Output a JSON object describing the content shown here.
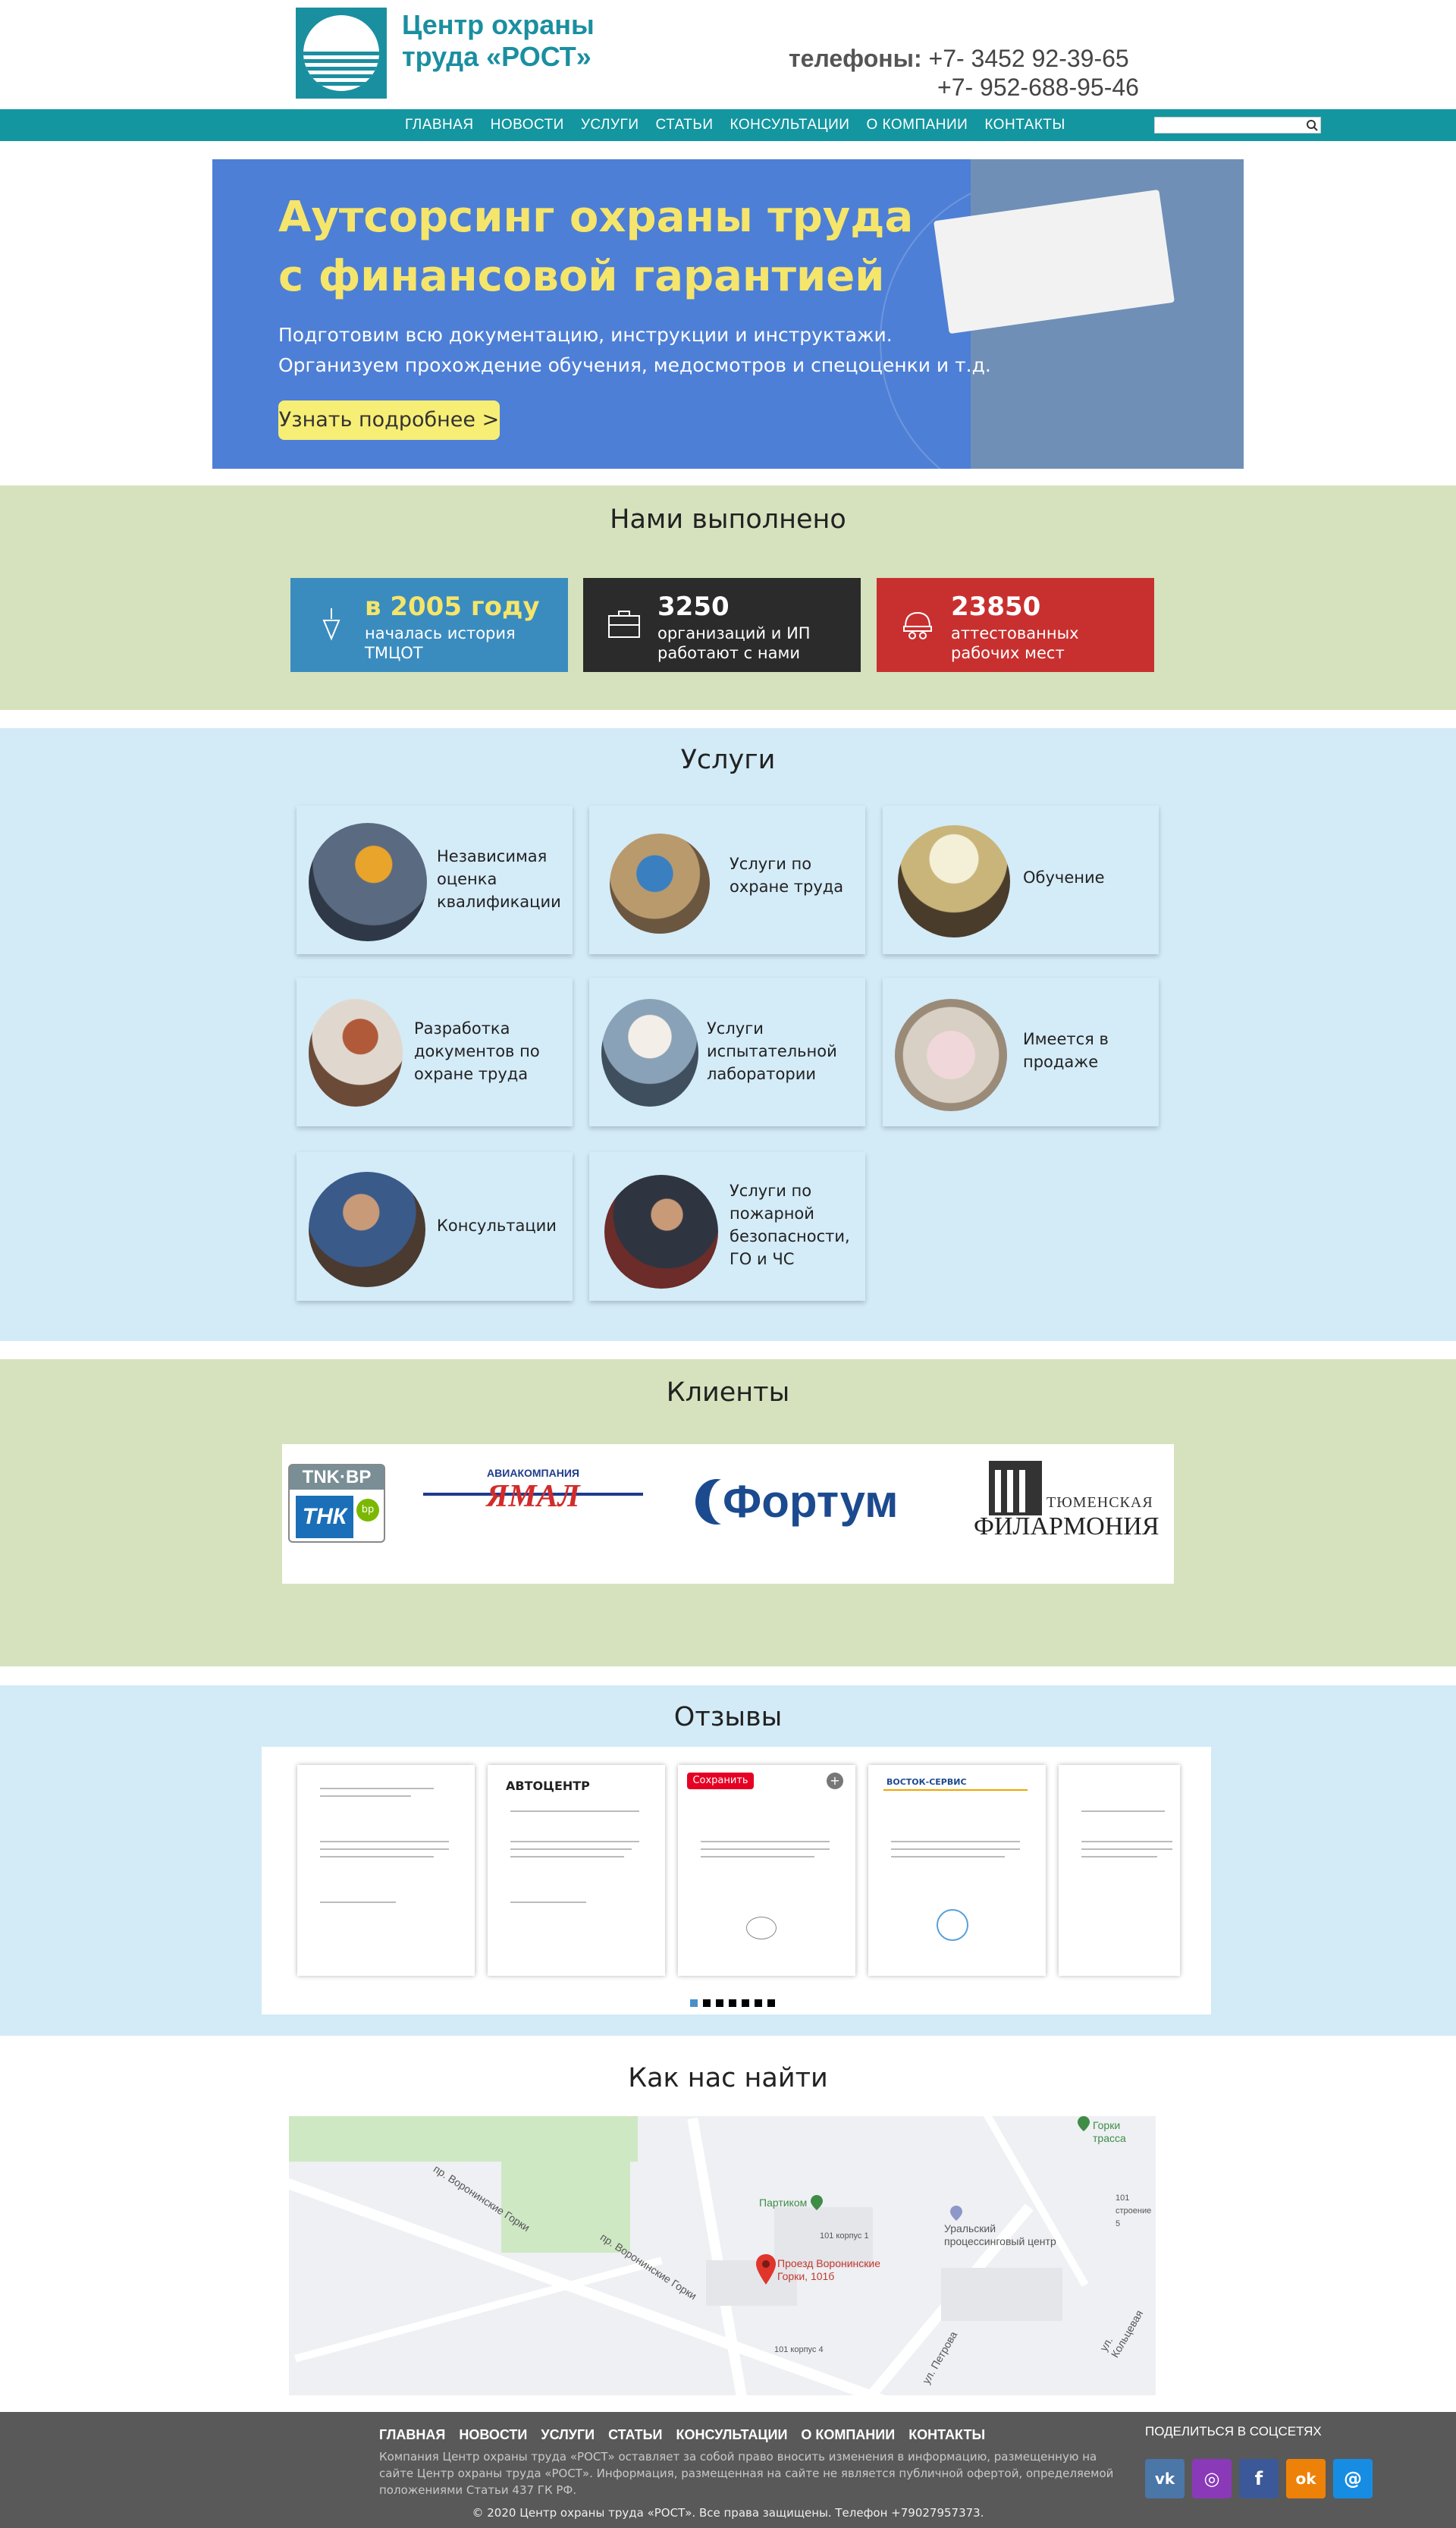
{
  "header": {
    "logo_line1": "Центр охраны",
    "logo_line2": "труда «РОСТ»",
    "phones_label": "телефоны:",
    "phone1": "+7- 3452 92-39-65",
    "phone2": "+7- 952-688-95-46"
  },
  "nav": {
    "items": [
      "ГЛАВНАЯ",
      "НОВОСТИ",
      "УСЛУГИ",
      "СТАТЬИ",
      "КОНСУЛЬТАЦИИ",
      "О КОМПАНИИ",
      "КОНТАКТЫ"
    ],
    "search_placeholder": ""
  },
  "banner": {
    "title_line1": "Аутсорсинг охраны труда",
    "title_line2": "с финансовой гарантией",
    "sub_line1": "Подготовим всю документацию, инструкции и инструктажи.",
    "sub_line2": "Организуем прохождение обучения, медосмотров и спецоценки и т.д.",
    "button": "Узнать подробнее >"
  },
  "done": {
    "title": "Нами выполнено",
    "stats": [
      {
        "big": "в 2005 году",
        "small": "началась история ТМЦОТ",
        "color": "#3a8cbf"
      },
      {
        "big": "3250",
        "small": "организаций и ИП работают с нами",
        "color": "#2b2b2b"
      },
      {
        "big": "23850",
        "small": "аттестованных рабочих мест",
        "color": "#c8302f"
      }
    ]
  },
  "services": {
    "title": "Услуги",
    "items": [
      "Независимая оценка квалификации",
      "Услуги по охране труда",
      "Обучение",
      "Разработка документов по охране труда",
      "Услуги испытательной лаборатории",
      "Имеется в продаже",
      "Консультации",
      "Услуги по пожарной безопасности, ГО и ЧС"
    ]
  },
  "clients": {
    "title": "Клиенты",
    "logos": [
      "TNK·BP",
      "ТНК",
      "bp",
      "АВИАКОМПАНИЯ",
      "ЯМАЛ",
      "Фортум",
      "ТЮМЕНСКАЯ",
      "ФИЛАРМОНИЯ"
    ]
  },
  "reviews": {
    "title": "Отзывы",
    "save_label": "Сохранить",
    "doc_headers": [
      "",
      "АВТОЦЕНТР",
      "",
      "ВОСТОК-СЕРВИС",
      ""
    ]
  },
  "map": {
    "title": "Как нас найти",
    "labels": {
      "marker": "Проезд Воронинские Горки, 101б",
      "partikom": "Партиком",
      "center": "Уральский процессинговый центр",
      "gorki": "Горки трасса",
      "street1": "пр. Воронинские Горки",
      "street2": "пр. Воронинские Горки",
      "street3": "ул. Петрова",
      "street4": "ул. Кольцевая",
      "num1": "101 корпус 4",
      "num2": "101 корпус 1",
      "num3": "101 строение 5"
    }
  },
  "footer": {
    "nav": [
      "ГЛАВНАЯ",
      "НОВОСТИ",
      "УСЛУГИ",
      "СТАТЬИ",
      "КОНСУЛЬТАЦИИ",
      "О КОМПАНИИ",
      "КОНТАКТЫ"
    ],
    "desc": "Компания Центр охраны труда «РОСТ» оставляет за собой право вносить изменения в информацию, размещенную на сайте Центр охраны труда «РОСТ». Информация, размещенная на сайте не является публичной офертой, определяемой положениями Статьи 437 ГК РФ.",
    "copy": "© 2020 Центр охраны труда «РОСТ». Все права защищены. Телефон +79027957373.",
    "share": "ПОДЕЛИТЬСЯ В СОЦСЕТЯХ",
    "social": [
      {
        "icon": "vk-icon",
        "glyph": "vk",
        "color": "#4a76a8"
      },
      {
        "icon": "instagram-icon",
        "glyph": "◎",
        "color": "#8a3ab9"
      },
      {
        "icon": "facebook-icon",
        "glyph": "f",
        "color": "#3b5998"
      },
      {
        "icon": "odnoklassniki-icon",
        "glyph": "ok",
        "color": "#ee8208"
      },
      {
        "icon": "mail-icon",
        "glyph": "@",
        "color": "#168de2"
      }
    ]
  }
}
